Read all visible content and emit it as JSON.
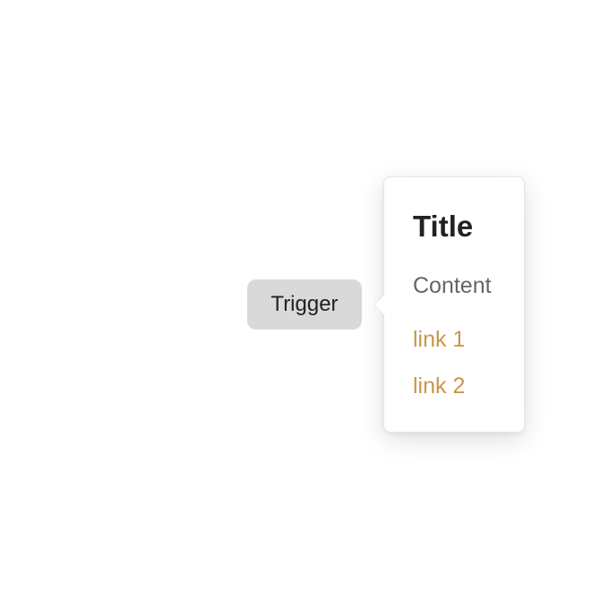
{
  "trigger": {
    "label": "Trigger"
  },
  "popover": {
    "title": "Title",
    "content": "Content",
    "links": [
      {
        "label": "link 1"
      },
      {
        "label": "link 2"
      }
    ]
  },
  "colors": {
    "trigger_bg": "#d9d9d9",
    "link": "#c9974a",
    "content_text": "#666666",
    "title_text": "#222222"
  }
}
